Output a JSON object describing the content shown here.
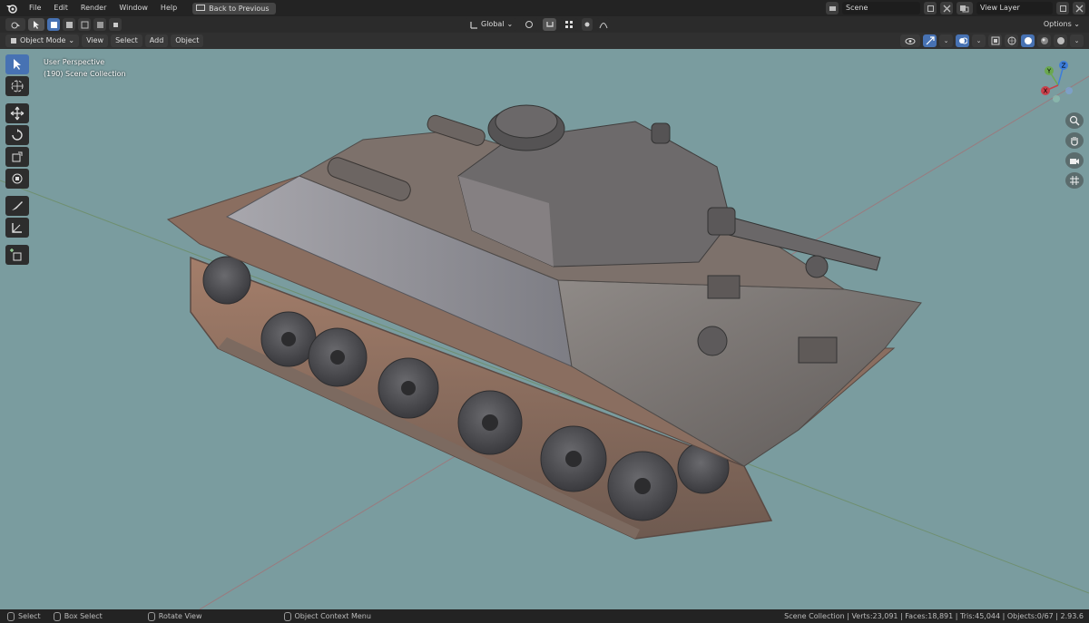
{
  "menu": {
    "items": [
      "File",
      "Edit",
      "Render",
      "Window",
      "Help"
    ],
    "back_label": "Back to Previous"
  },
  "scene_field": {
    "value": "Scene"
  },
  "view_layer_field": {
    "value": "View Layer"
  },
  "toolbar": {
    "transform_orientation": "Global",
    "options_label": "Options"
  },
  "header": {
    "mode": "Object Mode",
    "view": "View",
    "select": "Select",
    "add": "Add",
    "object": "Object"
  },
  "viewport": {
    "perspective": "User Perspective",
    "collection": "(190) Scene Collection",
    "background_color": "#7a9c9f",
    "gizmo_axes": [
      "Z",
      "Y",
      "X"
    ]
  },
  "status": {
    "select": "Select",
    "box_select": "Box Select",
    "rotate_view": "Rotate View",
    "context_menu": "Object Context Menu",
    "stats": "Scene Collection | Verts:23,091 | Faces:18,891 | Tris:45,044 | Objects:0/67 | 2.93.6"
  },
  "icons": [
    "blender-logo",
    "select-tool-icon",
    "cursor-icon",
    "move-icon",
    "rotate-icon",
    "scale-icon",
    "transform-icon",
    "annotate-icon",
    "measure-icon",
    "add-cube-icon",
    "zoom-icon",
    "hand-icon",
    "camera-icon",
    "grid-icon"
  ]
}
